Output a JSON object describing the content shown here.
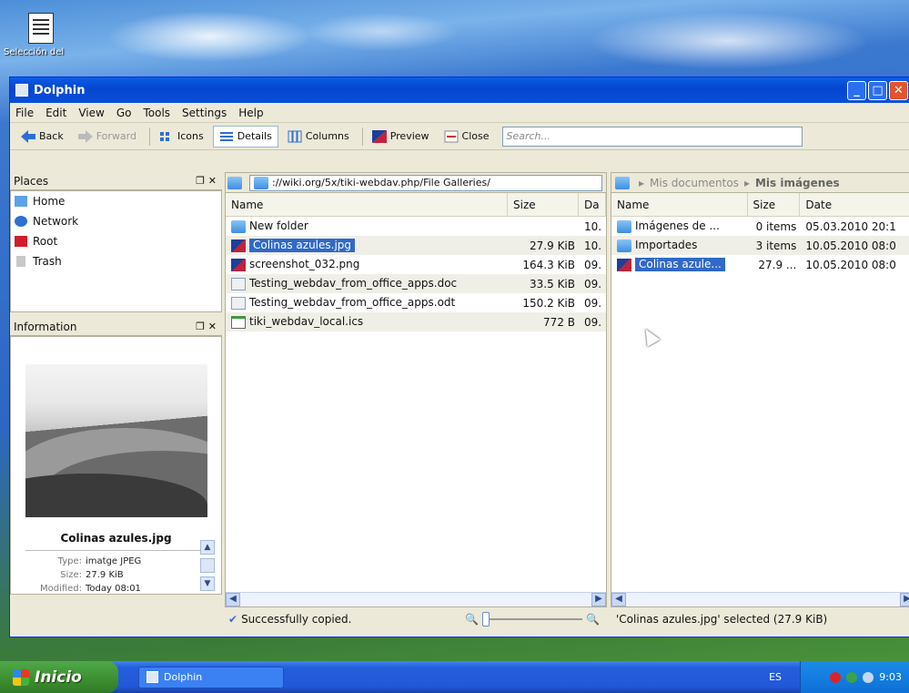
{
  "desktop": {
    "icon_label": "Selección del"
  },
  "window": {
    "title": "Dolphin"
  },
  "menu": [
    "File",
    "Edit",
    "View",
    "Go",
    "Tools",
    "Settings",
    "Help"
  ],
  "toolbar": {
    "back": "Back",
    "forward": "Forward",
    "icons": "Icons",
    "details": "Details",
    "columns": "Columns",
    "preview": "Preview",
    "close": "Close",
    "search_placeholder": "Search..."
  },
  "places": {
    "title": "Places",
    "ctrls": "❐ ✕",
    "items": [
      "Home",
      "Network",
      "Root",
      "Trash"
    ]
  },
  "information": {
    "title": "Information",
    "ctrls": "❐ ✕",
    "file_name": "Colinas azules.jpg",
    "type_label": "Type:",
    "type_value": "imatge JPEG",
    "size_label": "Size:",
    "size_value": "27.9 KiB",
    "modified_label": "Modified:",
    "modified_value": "Today 08:01"
  },
  "left_pane": {
    "location": "://wiki.org/5x/tiki-webdav.php/File Galleries/",
    "columns": {
      "name": "Name",
      "size": "Size",
      "date": "Da"
    },
    "rows": [
      {
        "name": "New folder",
        "size": "",
        "date": "10.",
        "icon": "folder-icon"
      },
      {
        "name": "Colinas azules.jpg",
        "size": "27.9 KiB",
        "date": "10.",
        "icon": "image-icon",
        "selected": true
      },
      {
        "name": "screenshot_032.png",
        "size": "164.3 KiB",
        "date": "09.",
        "icon": "image-icon"
      },
      {
        "name": "Testing_webdav_from_office_apps.doc",
        "size": "33.5 KiB",
        "date": "09.",
        "icon": "document-icon"
      },
      {
        "name": "Testing_webdav_from_office_apps.odt",
        "size": "150.2 KiB",
        "date": "09.",
        "icon": "document-icon"
      },
      {
        "name": "tiki_webdav_local.ics",
        "size": "772 B",
        "date": "09.",
        "icon": "calendar-icon"
      }
    ],
    "status": "Successfully copied."
  },
  "right_pane": {
    "breadcrumb": [
      "Mis documentos",
      "Mis imágenes"
    ],
    "columns": {
      "name": "Name",
      "size": "Size",
      "date": "Date"
    },
    "rows": [
      {
        "name": "Imágenes de ...",
        "size": "0 items",
        "date": "05.03.2010 20:1",
        "icon": "folder-icon"
      },
      {
        "name": "Importades",
        "size": "3 items",
        "date": "10.05.2010 08:0",
        "icon": "folder-icon"
      },
      {
        "name": "Colinas azule...",
        "size": "27.9 ...",
        "date": "10.05.2010 08:0",
        "icon": "image-icon",
        "selected": true
      }
    ],
    "status": "'Colinas azules.jpg' selected (27.9 KiB)"
  },
  "taskbar": {
    "start": "Inicio",
    "task": "Dolphin",
    "lang": "ES",
    "clock": "9:03"
  }
}
